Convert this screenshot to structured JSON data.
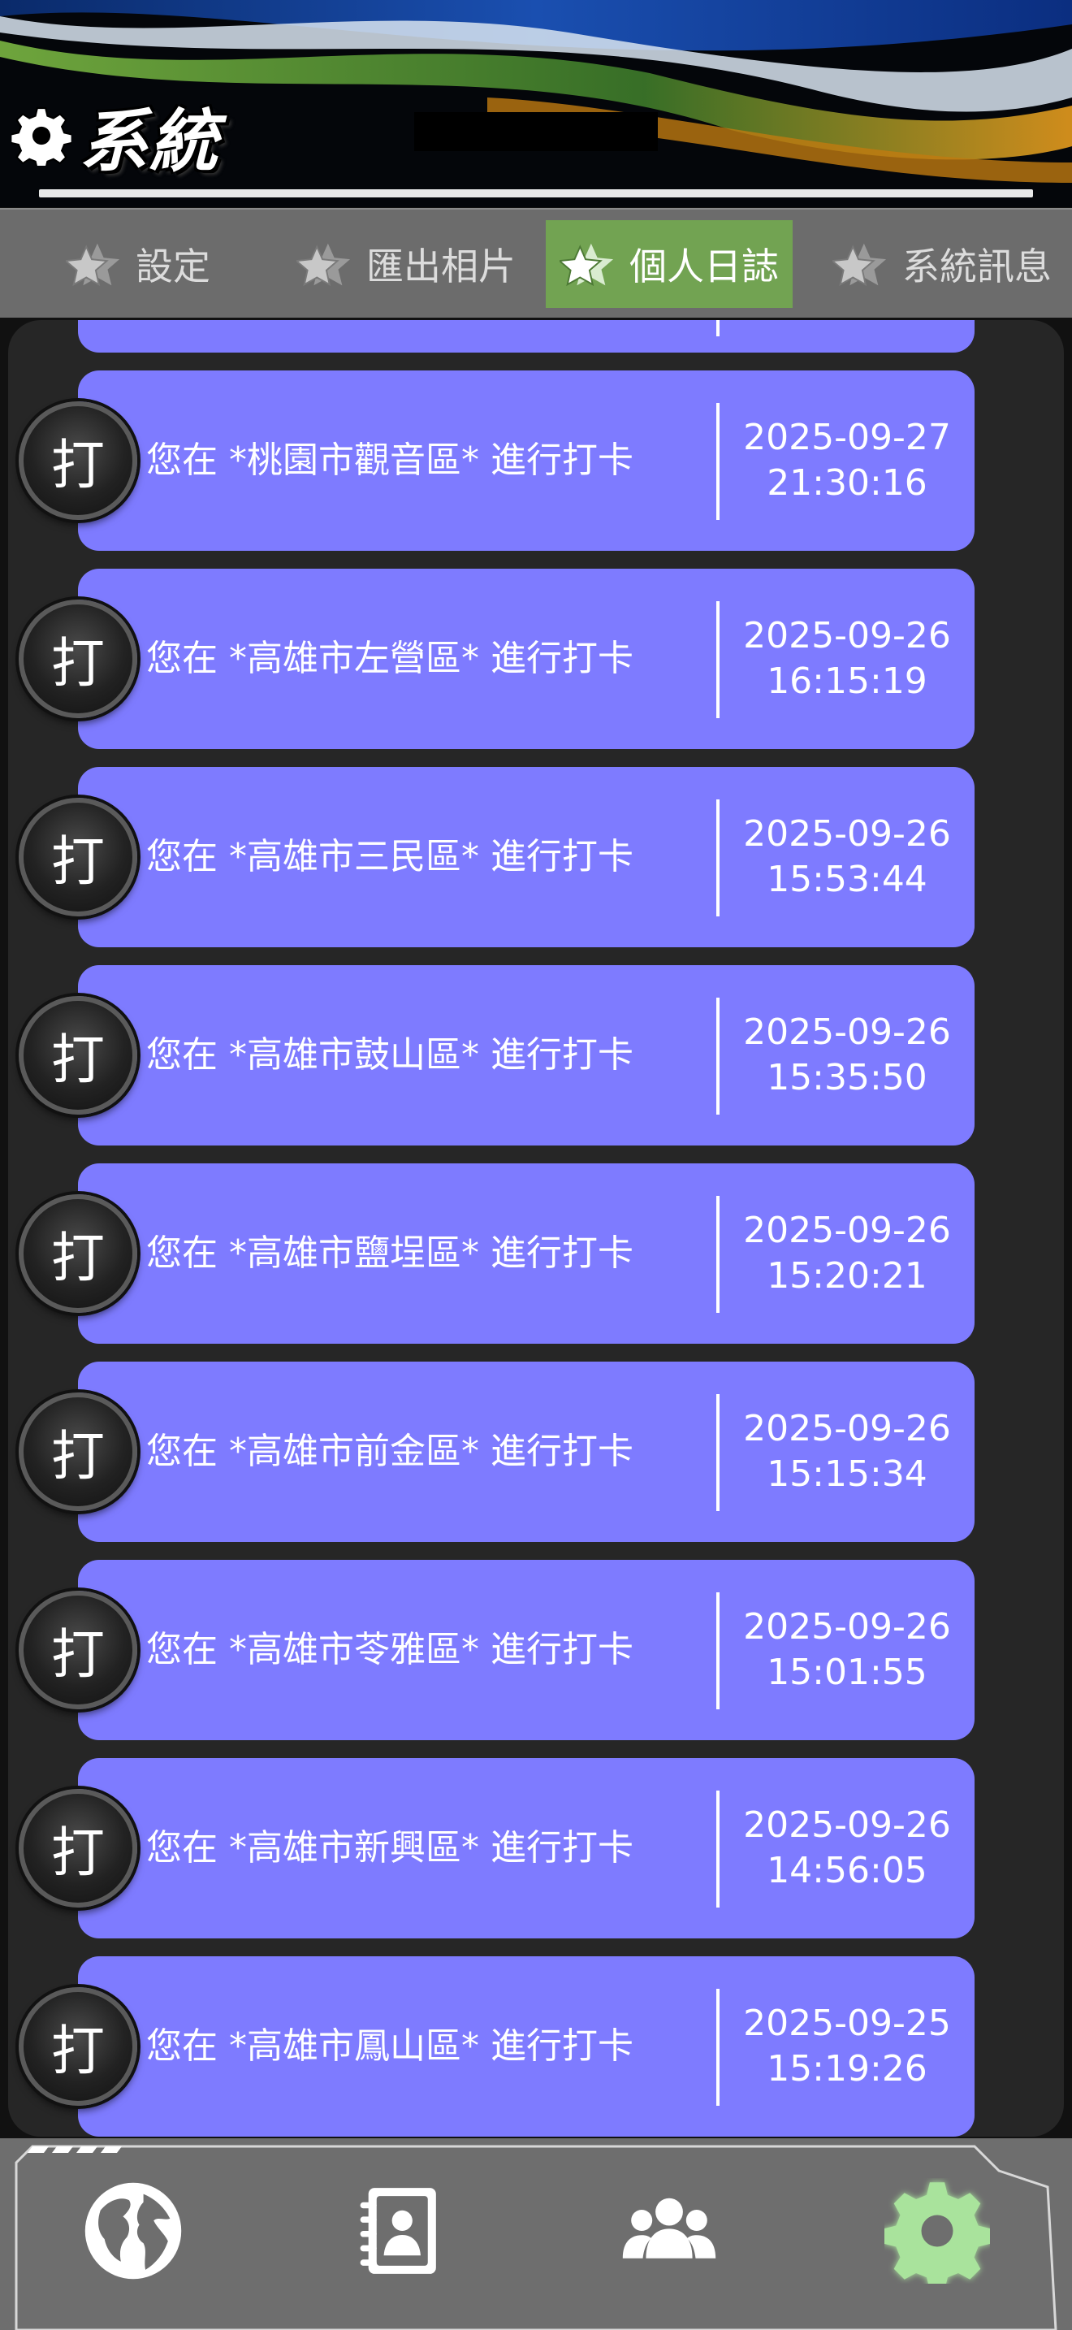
{
  "header": {
    "title": "系統",
    "title_icon": "gear-icon"
  },
  "tabs": [
    {
      "label": "設定",
      "icon": "star-icon",
      "active": false
    },
    {
      "label": "匯出相片",
      "icon": "star-icon",
      "active": false
    },
    {
      "label": "個人日誌",
      "icon": "star-icon",
      "active": true
    },
    {
      "label": "系統訊息",
      "icon": "star-icon",
      "active": false
    }
  ],
  "log": {
    "badge_label": "打",
    "entries": [
      {
        "message": "您在 *桃園市觀音區* 進行打卡",
        "date": "2025-09-27",
        "time": "21:30:16"
      },
      {
        "message": "您在 *高雄市左營區* 進行打卡",
        "date": "2025-09-26",
        "time": "16:15:19"
      },
      {
        "message": "您在 *高雄市三民區* 進行打卡",
        "date": "2025-09-26",
        "time": "15:53:44"
      },
      {
        "message": "您在 *高雄市鼓山區* 進行打卡",
        "date": "2025-09-26",
        "time": "15:35:50"
      },
      {
        "message": "您在 *高雄市鹽埕區* 進行打卡",
        "date": "2025-09-26",
        "time": "15:20:21"
      },
      {
        "message": "您在 *高雄市前金區* 進行打卡",
        "date": "2025-09-26",
        "time": "15:15:34"
      },
      {
        "message": "您在 *高雄市苓雅區* 進行打卡",
        "date": "2025-09-26",
        "time": "15:01:55"
      },
      {
        "message": "您在 *高雄市新興區* 進行打卡",
        "date": "2025-09-26",
        "time": "14:56:05"
      },
      {
        "message": "您在 *高雄市鳳山區* 進行打卡",
        "date": "2025-09-25",
        "time": "15:19:26"
      }
    ]
  },
  "bottom_nav": [
    {
      "icon": "globe-icon",
      "active": false
    },
    {
      "icon": "contacts-book-icon",
      "active": false
    },
    {
      "icon": "group-icon",
      "active": false
    },
    {
      "icon": "gear-icon",
      "active": true
    }
  ],
  "colors": {
    "entry_bg": "#7e7bff",
    "active_tab": "#72a352",
    "active_nav_icon": "#a9e39c"
  }
}
